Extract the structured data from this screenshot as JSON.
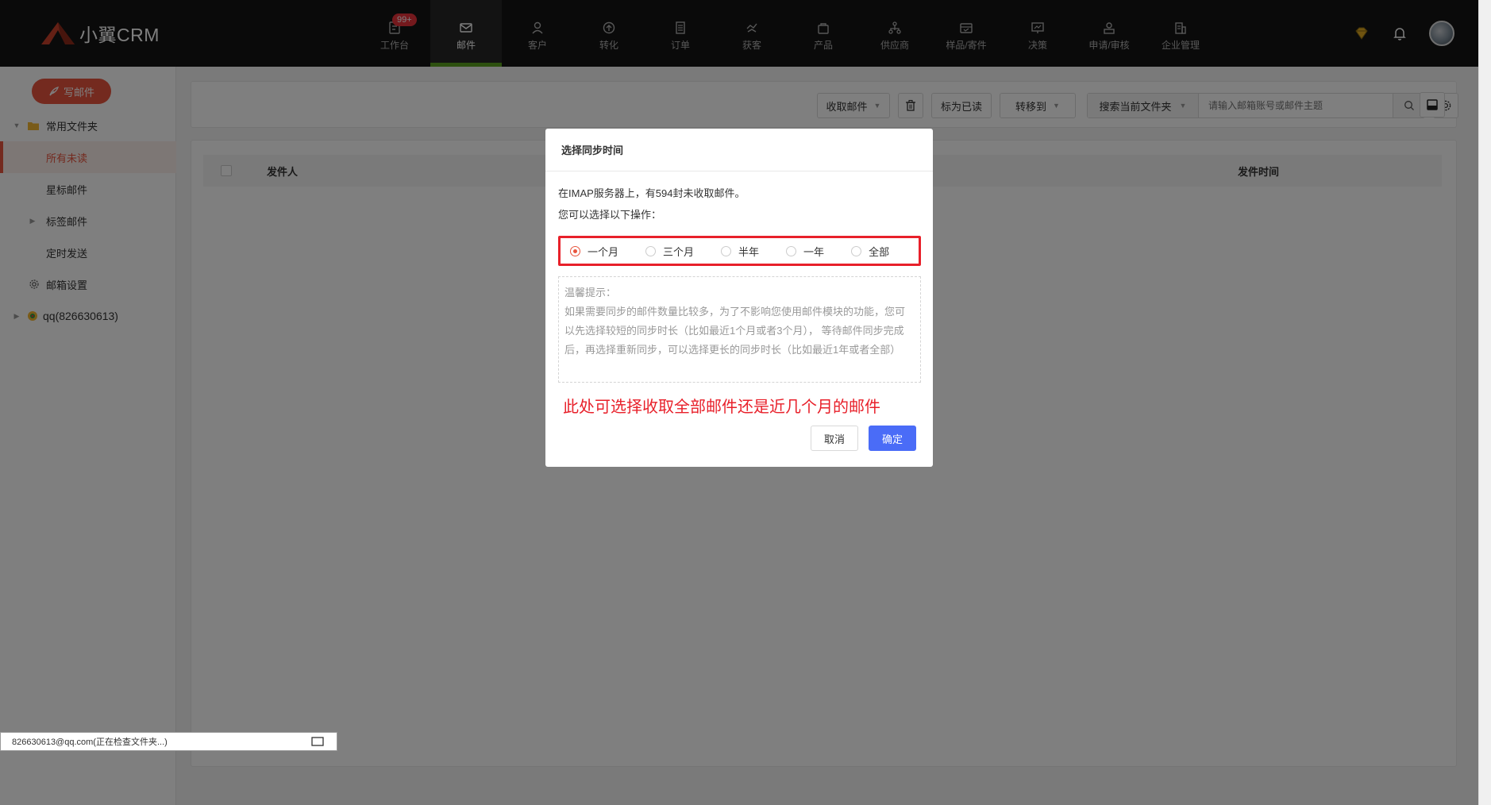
{
  "app": {
    "logo_text": "小翼CRM",
    "brand_color": "#e8553e",
    "nav_accent": "#5aa11f"
  },
  "nav": {
    "items": [
      {
        "label": "工作台",
        "icon": "workbench-icon",
        "badge": "99+"
      },
      {
        "label": "邮件",
        "icon": "mail-icon",
        "active": true
      },
      {
        "label": "客户",
        "icon": "customer-icon"
      },
      {
        "label": "转化",
        "icon": "conversion-icon"
      },
      {
        "label": "订单",
        "icon": "order-icon"
      },
      {
        "label": "获客",
        "icon": "acquire-icon"
      },
      {
        "label": "产品",
        "icon": "product-icon"
      },
      {
        "label": "供应商",
        "icon": "supplier-icon"
      },
      {
        "label": "样品/寄件",
        "icon": "sample-icon"
      },
      {
        "label": "决策",
        "icon": "decision-icon"
      },
      {
        "label": "申请/审核",
        "icon": "approval-icon"
      },
      {
        "label": "企业管理",
        "icon": "enterprise-icon"
      }
    ]
  },
  "sidebar": {
    "write_label": "写邮件",
    "items": [
      {
        "label": "常用文件夹"
      },
      {
        "label": "所有未读",
        "selected": true
      },
      {
        "label": "星标邮件"
      },
      {
        "label": "标签邮件"
      },
      {
        "label": "定时发送"
      },
      {
        "label": "邮箱设置"
      },
      {
        "label": "qq(826630613)"
      }
    ]
  },
  "toolbar": {
    "fetch_label": "收取邮件",
    "mark_read_label": "标为已读",
    "move_to_label": "转移到",
    "search_scope_label": "搜索当前文件夹",
    "search_placeholder": "请输入邮箱账号或邮件主题"
  },
  "list": {
    "columns": [
      "发件人",
      "发件时间"
    ]
  },
  "status": {
    "text": "826630613@qq.com(正在检查文件夹...)"
  },
  "modal": {
    "title": "选择同步时间",
    "line1": "在IMAP服务器上，有594封未收取邮件。",
    "line2": "您可以选择以下操作：",
    "options": [
      "一个月",
      "三个月",
      "半年",
      "一年",
      "全部"
    ],
    "selected_index": 0,
    "tip_title": "温馨提示：",
    "tip_body": "如果需要同步的邮件数量比较多，为了不影响您使用邮件模块的功能，您可以先选择较短的同步时长（比如最近1个月或者3个月）， 等待邮件同步完成后，再选择重新同步，可以选择更长的同步时长（比如最近1年或者全部）",
    "annotation": "此处可选择收取全部邮件还是近几个月的邮件",
    "cancel_label": "取消",
    "ok_label": "确定"
  }
}
